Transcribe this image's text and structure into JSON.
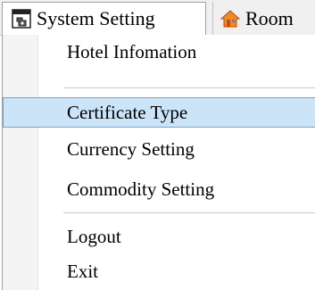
{
  "menubar": {
    "items": [
      {
        "label": "System Setting",
        "icon": "settings-window-icon"
      },
      {
        "label": "Room",
        "icon": "house-icon"
      }
    ]
  },
  "dropdown": {
    "items": [
      {
        "label": "Hotel Infomation",
        "selected": false
      },
      {
        "label": "Certificate Type",
        "selected": true
      },
      {
        "label": "Currency Setting",
        "selected": false
      },
      {
        "label": "Commodity Setting",
        "selected": false
      },
      {
        "label": "Logout",
        "selected": false
      },
      {
        "label": "Exit",
        "selected": false
      }
    ]
  },
  "colors": {
    "selection_bg": "#cce4f7",
    "selection_border": "#6aa5d8"
  }
}
